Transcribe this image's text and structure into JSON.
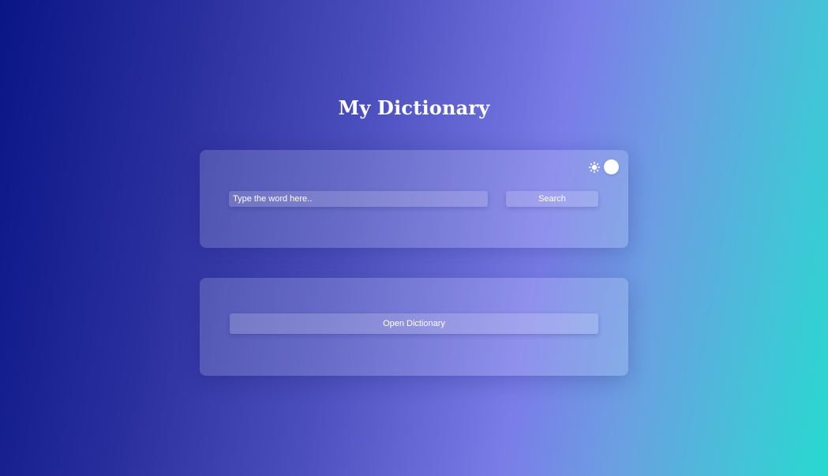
{
  "header": {
    "title": "My Dictionary"
  },
  "search_card": {
    "input": {
      "value": "",
      "placeholder": "Type the word here.."
    },
    "search_label": "Search",
    "theme_toggle": {
      "icon": "sun-icon",
      "state": "light"
    }
  },
  "open_card": {
    "open_label": "Open Dictionary"
  },
  "colors": {
    "gradient_start": "#0a1585",
    "gradient_mid": "#7a7ce8",
    "gradient_end": "#27d9d0",
    "text": "#ffffff"
  }
}
